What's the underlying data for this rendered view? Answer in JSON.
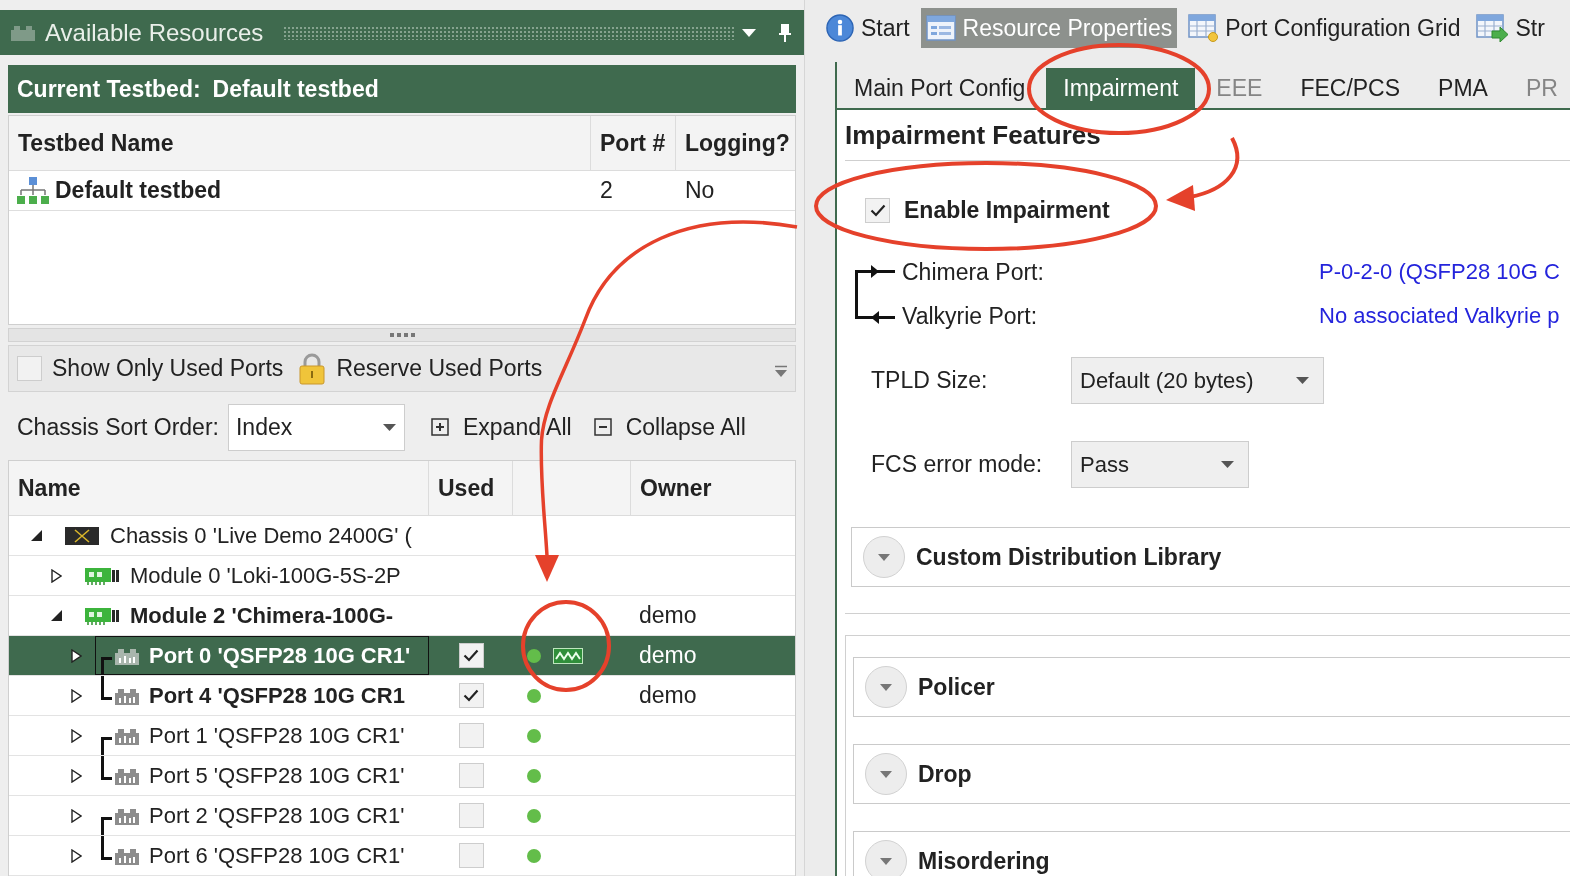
{
  "resources_panel": {
    "title": "Available Resources"
  },
  "current_testbed": {
    "label": "Current Testbed:",
    "name": "Default testbed"
  },
  "testbed_table": {
    "columns": [
      "Testbed Name",
      "Port #",
      "Logging?"
    ],
    "rows": [
      {
        "name": "Default testbed",
        "ports": "2",
        "logging": "No"
      }
    ]
  },
  "port_filter": {
    "show_only_used": {
      "label": "Show Only Used Ports",
      "checked": false
    },
    "reserve_button": "Reserve Used Ports"
  },
  "sort": {
    "label": "Chassis Sort Order:",
    "value": "Index"
  },
  "tree_actions": {
    "expand_all": "Expand All",
    "collapse_all": "Collapse All"
  },
  "tree": {
    "columns": [
      "Name",
      "Used",
      "Owner"
    ],
    "nodes": [
      {
        "kind": "chassis",
        "name": "Chassis 0 'Live Demo 2400G' (",
        "expanded": true,
        "selected": false,
        "reserved": false,
        "children": [
          {
            "kind": "module",
            "name": "Module 0 'Loki-100G-5S-2P",
            "expanded": false,
            "selected": false,
            "reserved": false
          },
          {
            "kind": "module",
            "name": "Module 2 'Chimera-100G-",
            "expanded": true,
            "selected": false,
            "reserved": true,
            "owner": "demo",
            "children": [
              {
                "kind": "port",
                "name": "Port 0 'QSFP28 10G CR1'",
                "expanded": false,
                "selected": true,
                "reserved": true,
                "used": true,
                "link_up": true,
                "traffic": true,
                "pair_start": true,
                "owner": "demo"
              },
              {
                "kind": "port",
                "name": "Port 4 'QSFP28 10G CR1",
                "expanded": false,
                "selected": false,
                "reserved": true,
                "used": true,
                "link_up": true,
                "traffic": false,
                "pair_start": false,
                "owner": "demo"
              },
              {
                "kind": "port",
                "name": "Port 1 'QSFP28 10G CR1'",
                "expanded": false,
                "selected": false,
                "reserved": false,
                "used": false,
                "link_up": true,
                "traffic": false,
                "pair_start": true
              },
              {
                "kind": "port",
                "name": "Port 5 'QSFP28 10G CR1'",
                "expanded": false,
                "selected": false,
                "reserved": false,
                "used": false,
                "link_up": true,
                "traffic": false,
                "pair_start": false
              },
              {
                "kind": "port",
                "name": "Port 2 'QSFP28 10G CR1'",
                "expanded": false,
                "selected": false,
                "reserved": false,
                "used": false,
                "link_up": true,
                "traffic": false,
                "pair_start": true
              },
              {
                "kind": "port",
                "name": "Port 6 'QSFP28 10G CR1'",
                "expanded": false,
                "selected": false,
                "reserved": false,
                "used": false,
                "link_up": true,
                "traffic": false,
                "pair_start": false
              }
            ]
          }
        ]
      }
    ]
  },
  "document_tabs": [
    {
      "kind": "info",
      "label": "Start",
      "selected": false
    },
    {
      "kind": "properties",
      "label": "Resource Properties",
      "selected": true
    },
    {
      "kind": "grid",
      "label": "Port Configuration Grid",
      "selected": false
    },
    {
      "kind": "stream",
      "label": "Str",
      "selected": false
    }
  ],
  "property_tabs": [
    {
      "label": "Main Port Config",
      "selected": false,
      "disabled": false
    },
    {
      "label": "Impairment",
      "selected": true,
      "disabled": false
    },
    {
      "label": "EEE",
      "selected": false,
      "disabled": true
    },
    {
      "label": "FEC/PCS",
      "selected": false,
      "disabled": false
    },
    {
      "label": "PMA",
      "selected": false,
      "disabled": false
    },
    {
      "label": "PR",
      "selected": false,
      "disabled": true
    }
  ],
  "impairment": {
    "title": "Impairment Features",
    "enable": {
      "label": "Enable Impairment",
      "checked": true
    },
    "ports": [
      {
        "label": "Chimera Port:",
        "value": "P-0-2-0 (QSFP28 10G C"
      },
      {
        "label": "Valkyrie Port:",
        "value": "No associated Valkyrie p"
      }
    ],
    "fields": [
      {
        "label": "TPLD Size:",
        "value": "Default (20 bytes)"
      },
      {
        "label": "FCS error mode:",
        "value": "Pass"
      }
    ],
    "library": {
      "title": "Custom Distribution Library",
      "expanded": false
    },
    "sections": [
      {
        "title": "Policer",
        "expanded": false
      },
      {
        "title": "Drop",
        "expanded": false
      },
      {
        "title": "Misordering",
        "expanded": false
      }
    ]
  }
}
